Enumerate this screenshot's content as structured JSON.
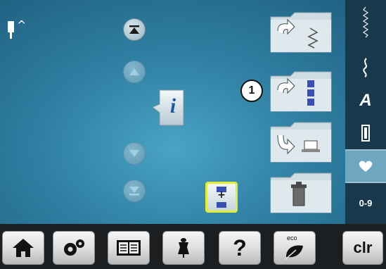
{
  "screen": {
    "background_color": "#2f7fa2",
    "needle": {
      "icon": "needle-icon",
      "indicator": "^"
    }
  },
  "navigation": {
    "top_button_icon": "jump-to-top-icon",
    "up_button_icon": "scroll-up-icon",
    "down_button_icon": "scroll-down-icon",
    "bottom_button_icon": "jump-to-bottom-icon"
  },
  "info": {
    "label": "i",
    "icon": "info-bubble-icon"
  },
  "folders": [
    {
      "name": "stitch-folder",
      "icon": "zigzag-stitch-icon"
    },
    {
      "name": "combination-folder",
      "icon": "combination-list-icon"
    },
    {
      "name": "memory-folder",
      "icon": "save-to-memory-icon"
    },
    {
      "name": "delete-folder",
      "icon": "trash-icon"
    }
  ],
  "callout": {
    "number": "1"
  },
  "combo_button": {
    "icon": "add-combination-icon",
    "label": "+"
  },
  "sidebar": {
    "items": [
      {
        "name": "practical-stitches",
        "icon": "straight-stitch-icon"
      },
      {
        "name": "decorative-stitches",
        "icon": "decorative-stitch-icon"
      },
      {
        "name": "alphabets",
        "label": "A"
      },
      {
        "name": "buttonholes",
        "icon": "buttonhole-icon"
      },
      {
        "name": "personal-program",
        "icon": "heart-icon"
      },
      {
        "name": "numbers",
        "label": "0-9"
      }
    ],
    "accent_color": "#6fa7c0"
  },
  "toolbar": {
    "home_icon": "home-icon",
    "setup_icon": "setup-gears-icon",
    "tutorial_icon": "tutorial-book-icon",
    "advisor_icon": "sewing-advisor-icon",
    "help_label": "?",
    "eco_label": "eco",
    "eco_icon": "eco-leaf-icon",
    "clr_label": "clr"
  }
}
